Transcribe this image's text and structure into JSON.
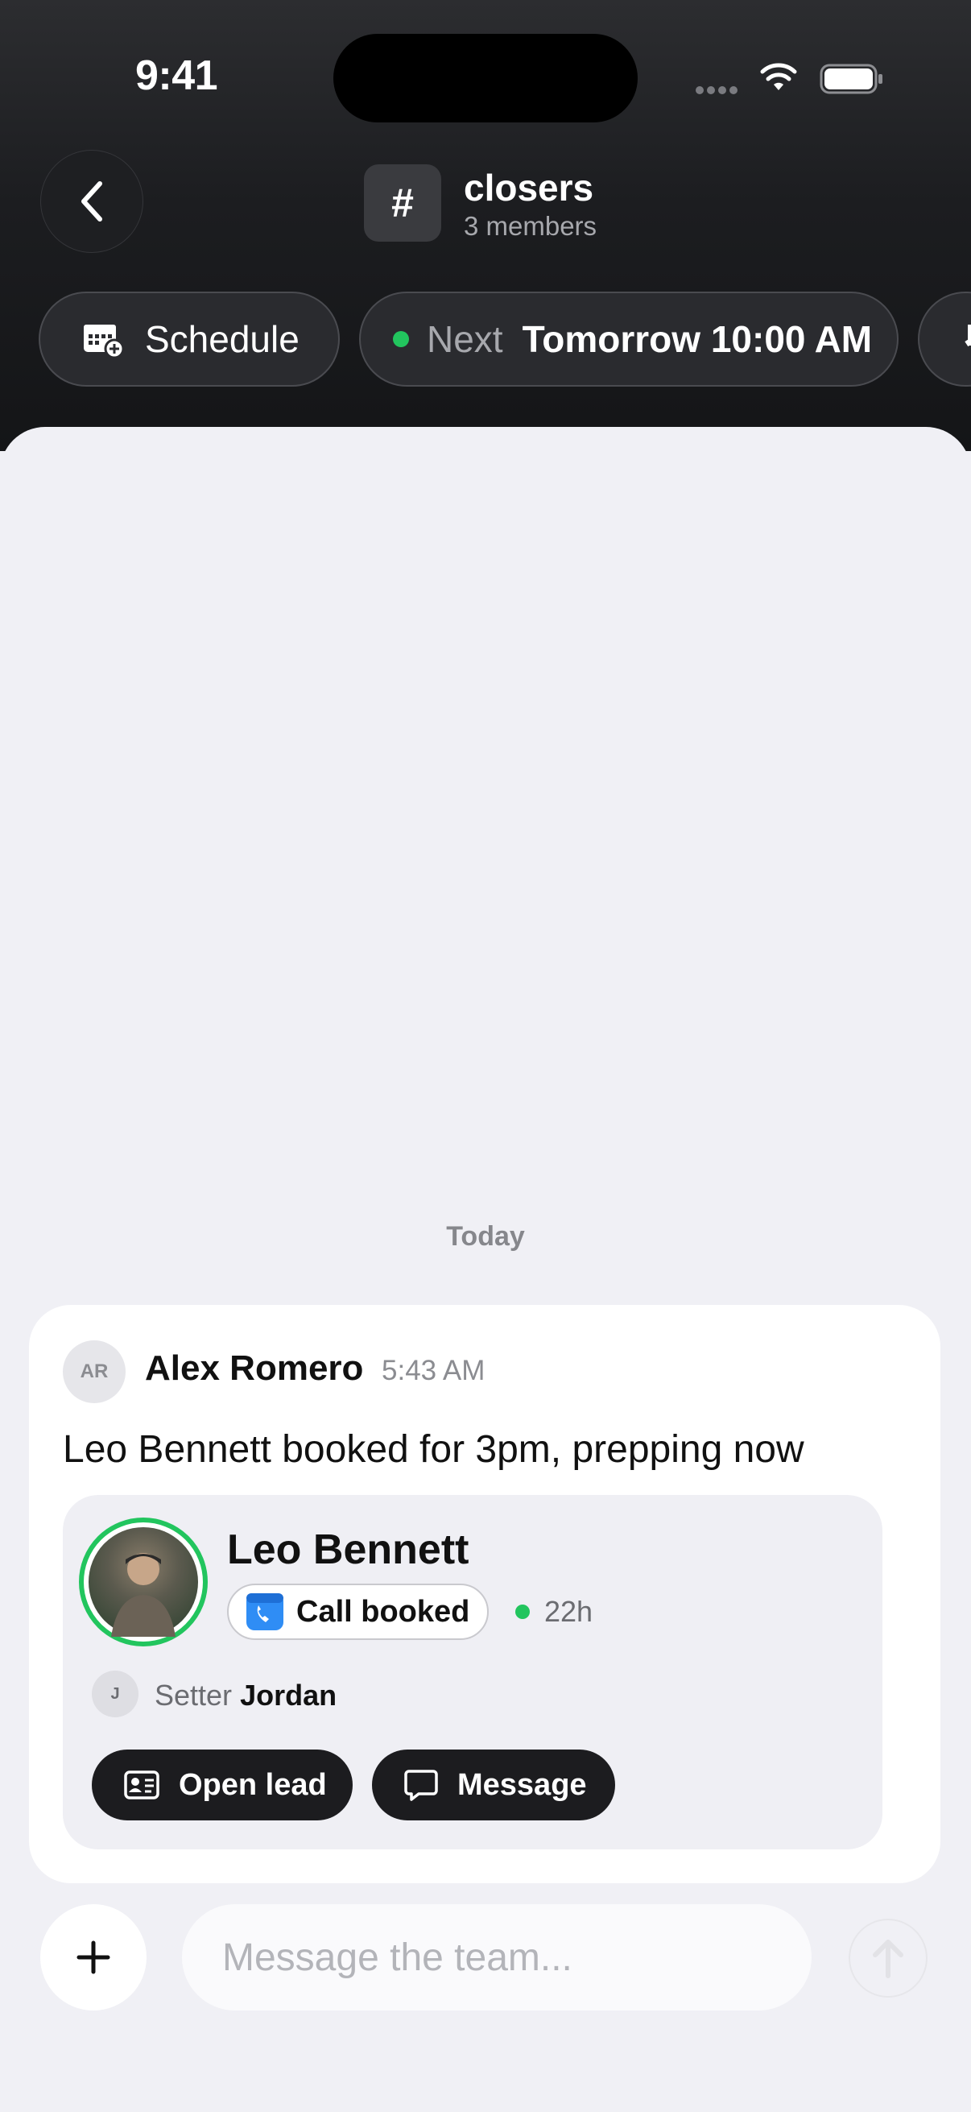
{
  "status_bar": {
    "time": "9:41"
  },
  "header": {
    "channel_symbol": "#",
    "channel_name": "closers",
    "member_count": "3 members"
  },
  "chips": {
    "schedule_label": "Schedule",
    "next_label": "Next",
    "next_value": "Tomorrow 10:00 AM"
  },
  "feed": {
    "date_divider": "Today",
    "message": {
      "avatar_initials": "AR",
      "author": "Alex Romero",
      "time": "5:43 AM",
      "text": "Leo Bennett booked for 3pm, prepping now",
      "lead_card": {
        "name": "Leo Bennett",
        "status_badge": "Call booked",
        "age": "22h",
        "setter_avatar_initial": "J",
        "setter_label": "Setter",
        "setter_name": "Jordan",
        "open_lead_label": "Open lead",
        "message_label": "Message"
      }
    }
  },
  "composer": {
    "placeholder": "Message the team..."
  },
  "colors": {
    "accent_green": "#22c55e",
    "dark": "#1c1c1f",
    "background": "#f0f0f5"
  },
  "icons": [
    "back-chevron-icon",
    "wifi-icon",
    "battery-icon",
    "calendar-add-icon",
    "phone-calendar-icon",
    "contact-card-icon",
    "chat-bubble-icon",
    "plus-icon",
    "send-arrow-icon"
  ]
}
